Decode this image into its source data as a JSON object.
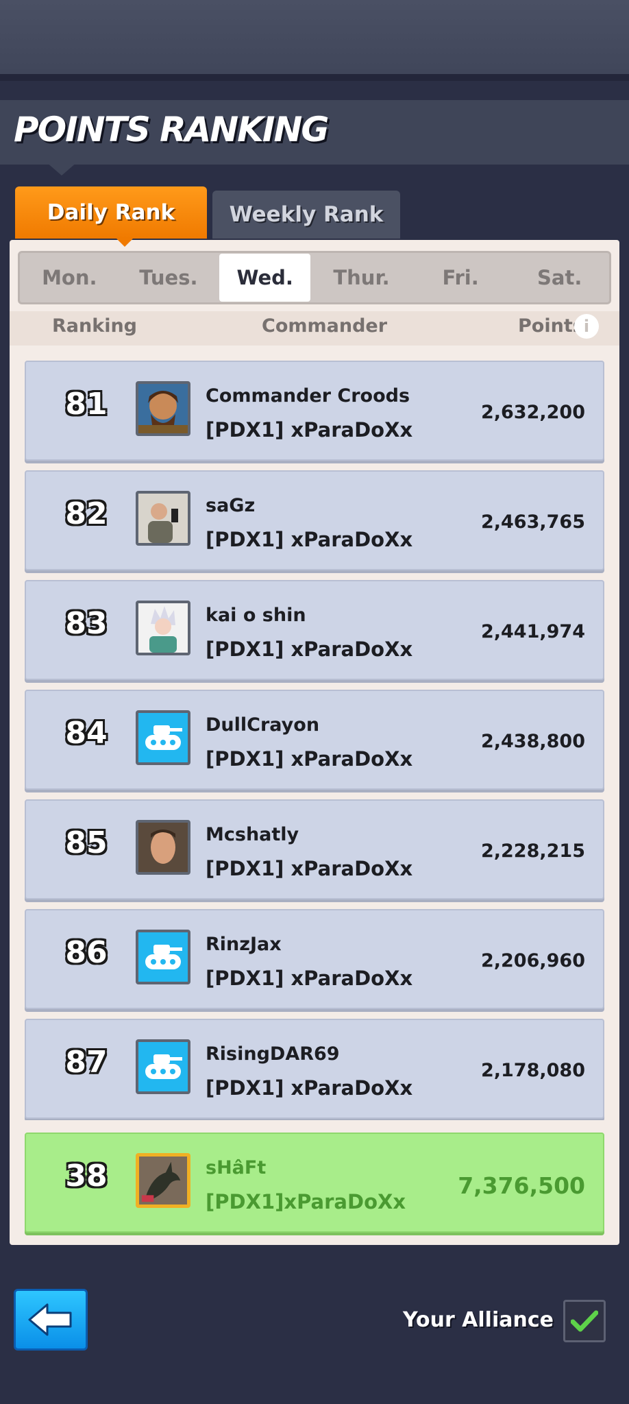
{
  "page": {
    "title": "POINTS RANKING"
  },
  "tabs": [
    {
      "label": "Daily Rank",
      "active": true
    },
    {
      "label": "Weekly Rank",
      "active": false
    }
  ],
  "days": [
    "Mon.",
    "Tues.",
    "Wed.",
    "Thur.",
    "Fri.",
    "Sat."
  ],
  "active_day": "Wed.",
  "headers": {
    "ranking": "Ranking",
    "commander": "Commander",
    "points": "Points"
  },
  "rows": [
    {
      "rank": "81",
      "name": "Commander Croods",
      "alliance": "[PDX1] xParaDoXx",
      "points": "2,632,200",
      "avatar": "croods-portrait"
    },
    {
      "rank": "82",
      "name": "saGz",
      "alliance": "[PDX1] xParaDoXx",
      "points": "2,463,765",
      "avatar": "man-selfie-portrait"
    },
    {
      "rank": "83",
      "name": "kai o shin",
      "alliance": "[PDX1] xParaDoXx",
      "points": "2,441,974",
      "avatar": "anime-character-portrait"
    },
    {
      "rank": "84",
      "name": "DullCrayon",
      "alliance": "[PDX1] xParaDoXx",
      "points": "2,438,800",
      "avatar": "tank-icon"
    },
    {
      "rank": "85",
      "name": "Mcshatly",
      "alliance": "[PDX1] xParaDoXx",
      "points": "2,228,215",
      "avatar": "man-portrait"
    },
    {
      "rank": "86",
      "name": "RinzJax",
      "alliance": "[PDX1] xParaDoXx",
      "points": "2,206,960",
      "avatar": "tank-icon"
    },
    {
      "rank": "87",
      "name": "RisingDAR69",
      "alliance": "[PDX1] xParaDoXx",
      "points": "2,178,080",
      "avatar": "tank-icon"
    }
  ],
  "my_row": {
    "rank": "38",
    "name": "sHâFt",
    "alliance": "[PDX1]xParaDoXx",
    "points": "7,376,500",
    "avatar": "dragon-portrait"
  },
  "footer": {
    "your_alliance_label": "Your Alliance",
    "your_alliance_checked": true
  },
  "colors": {
    "accent": "#f58a0a",
    "my_row": "#a8ed8a",
    "row_bg": "#cdd4e6",
    "tank_icon_bg": "#22b7f0"
  }
}
